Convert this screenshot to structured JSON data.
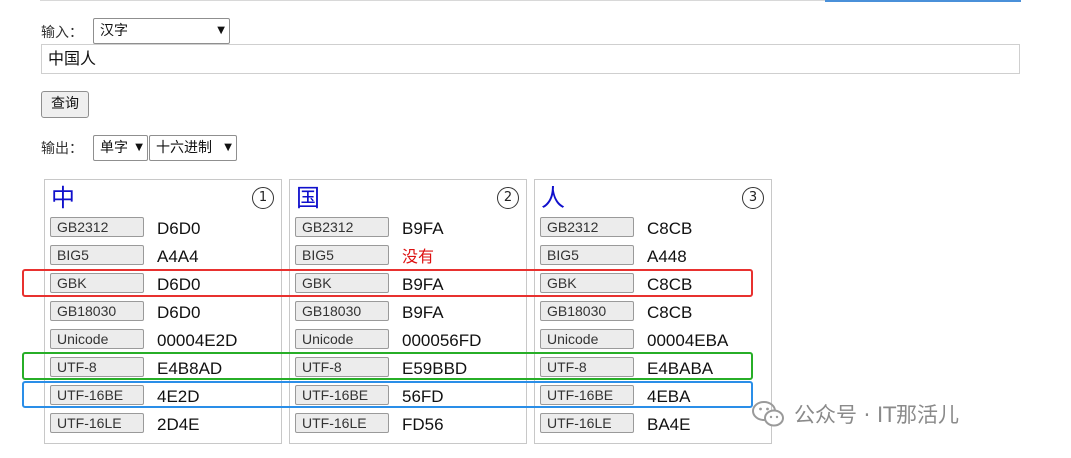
{
  "input_section": {
    "label": "输入：",
    "type_select": "汉字",
    "text_value": "中国人",
    "query_button": "查询"
  },
  "output_section": {
    "label": "输出：",
    "mode_select": "单字",
    "format_select": "十六进制"
  },
  "cards": [
    {
      "char": "中",
      "index": "1",
      "rows": [
        {
          "encoding": "GB2312",
          "value": "D6D0"
        },
        {
          "encoding": "BIG5",
          "value": "A4A4"
        },
        {
          "encoding": "GBK",
          "value": "D6D0"
        },
        {
          "encoding": "GB18030",
          "value": "D6D0"
        },
        {
          "encoding": "Unicode",
          "value": "00004E2D"
        },
        {
          "encoding": "UTF-8",
          "value": "E4B8AD"
        },
        {
          "encoding": "UTF-16BE",
          "value": "4E2D"
        },
        {
          "encoding": "UTF-16LE",
          "value": "2D4E"
        }
      ]
    },
    {
      "char": "国",
      "index": "2",
      "rows": [
        {
          "encoding": "GB2312",
          "value": "B9FA"
        },
        {
          "encoding": "BIG5",
          "value": "没有"
        },
        {
          "encoding": "GBK",
          "value": "B9FA"
        },
        {
          "encoding": "GB18030",
          "value": "B9FA"
        },
        {
          "encoding": "Unicode",
          "value": "000056FD"
        },
        {
          "encoding": "UTF-8",
          "value": "E59BBD"
        },
        {
          "encoding": "UTF-16BE",
          "value": "56FD"
        },
        {
          "encoding": "UTF-16LE",
          "value": "FD56"
        }
      ]
    },
    {
      "char": "人",
      "index": "3",
      "rows": [
        {
          "encoding": "GB2312",
          "value": "C8CB"
        },
        {
          "encoding": "BIG5",
          "value": "A448"
        },
        {
          "encoding": "GBK",
          "value": "C8CB"
        },
        {
          "encoding": "GB18030",
          "value": "C8CB"
        },
        {
          "encoding": "Unicode",
          "value": "00004EBA"
        },
        {
          "encoding": "UTF-8",
          "value": "E4BABA"
        },
        {
          "encoding": "UTF-16BE",
          "value": "4EBA"
        },
        {
          "encoding": "UTF-16LE",
          "value": "BA4E"
        }
      ]
    }
  ],
  "colors": {
    "char": "#1010cc",
    "missing": "#dd1111",
    "highlight_gbk": "#e8312f",
    "highlight_utf8": "#27ae27",
    "highlight_utf16be": "#2a8ee8"
  },
  "watermark": {
    "text": "公众号 · IT那活儿",
    "icon": "wechat-icon"
  }
}
